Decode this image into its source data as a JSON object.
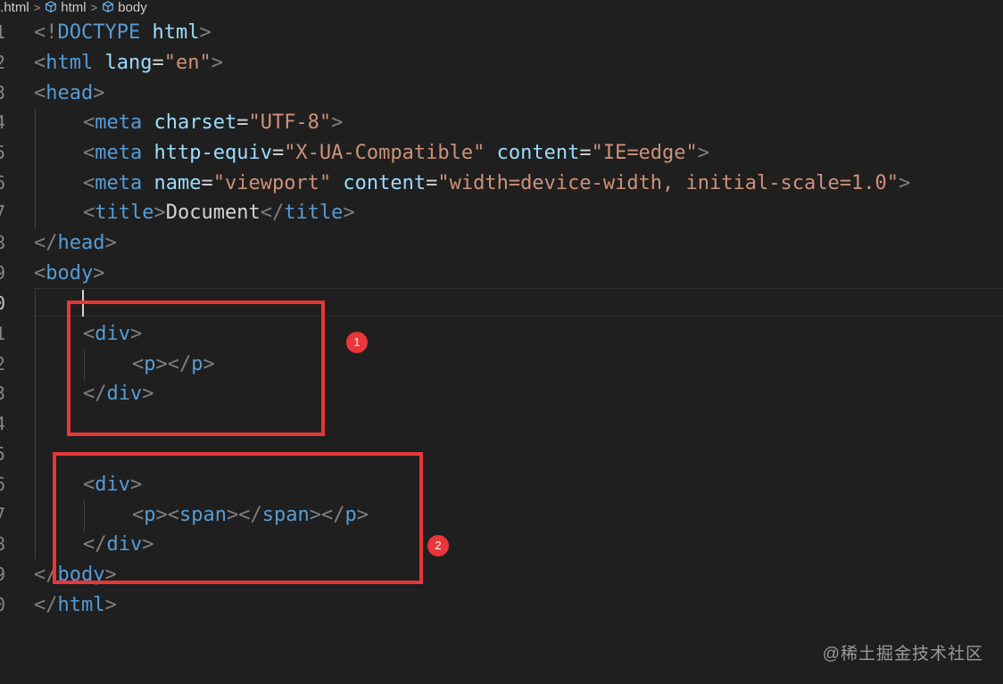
{
  "breadcrumb": {
    "file": "t.html",
    "items": [
      "html",
      "body"
    ]
  },
  "gutter": [
    "1",
    "2",
    "3",
    "4",
    "5",
    "6",
    "7",
    "8",
    "9",
    "0",
    "1",
    "2",
    "3",
    "4",
    "5",
    "6",
    "7",
    "8",
    "9",
    "0"
  ],
  "code": {
    "l1": {
      "a": "<!",
      "b": "DOCTYPE",
      "c": " ",
      "d": "html",
      "e": ">"
    },
    "l2": {
      "a": "<",
      "b": "html",
      "c": " ",
      "d": "lang",
      "e": "=",
      "f": "\"en\"",
      "g": ">"
    },
    "l3": {
      "a": "<",
      "b": "head",
      "c": ">"
    },
    "l4": {
      "a": "<",
      "b": "meta",
      "c": " ",
      "d": "charset",
      "e": "=",
      "f": "\"UTF-8\"",
      "g": ">"
    },
    "l5": {
      "a": "<",
      "b": "meta",
      "c": " ",
      "d": "http-equiv",
      "e": "=",
      "f": "\"X-UA-Compatible\"",
      "g": " ",
      "h": "content",
      "i": "=",
      "j": "\"IE=edge\"",
      "k": ">"
    },
    "l6": {
      "a": "<",
      "b": "meta",
      "c": " ",
      "d": "name",
      "e": "=",
      "f": "\"viewport\"",
      "g": " ",
      "h": "content",
      "i": "=",
      "j": "\"width=device-width, initial-scale=1.0\"",
      "k": ">"
    },
    "l7": {
      "a": "<",
      "b": "title",
      "c": ">",
      "d": "Document",
      "e": "</",
      "f": "title",
      "g": ">"
    },
    "l8": {
      "a": "</",
      "b": "head",
      "c": ">"
    },
    "l9": {
      "a": "<",
      "b": "body",
      "c": ">"
    },
    "l11": {
      "a": "<",
      "b": "div",
      "c": ">"
    },
    "l12": {
      "a": "<",
      "b": "p",
      "c": "></",
      "d": "p",
      "e": ">"
    },
    "l13": {
      "a": "</",
      "b": "div",
      "c": ">"
    },
    "l16": {
      "a": "<",
      "b": "div",
      "c": ">"
    },
    "l17": {
      "a": "<",
      "b": "p",
      "c": "><",
      "d": "span",
      "e": "></",
      "f": "span",
      "g": "></",
      "h": "p",
      "i": ">"
    },
    "l18": {
      "a": "</",
      "b": "div",
      "c": ">"
    },
    "l19": {
      "a": "</",
      "b": "body",
      "c": ">"
    },
    "l20": {
      "a": "</",
      "b": "html",
      "c": ">"
    }
  },
  "annotations": {
    "badge1": "1",
    "badge2": "2"
  },
  "colors": {
    "highlight": "#e8363a",
    "tag": "#569cd6",
    "attribute": "#9cdcfe",
    "string": "#ce9178",
    "bracket": "#808080"
  },
  "watermark": "@稀土掘金技术社区"
}
